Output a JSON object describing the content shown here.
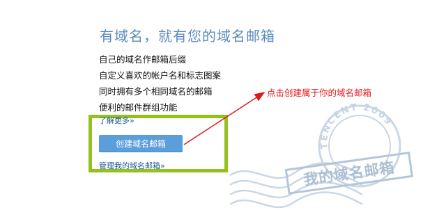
{
  "headline": "有域名，就有您的域名邮箱",
  "features": [
    "自己的域名作邮箱后缀",
    "自定义喜欢的帐户名和标志图案",
    "同时拥有多个相同域名的邮箱",
    "便利的邮件群组功能"
  ],
  "links": {
    "learn_more": "了解更多»",
    "manage": "管理我的域名邮箱»"
  },
  "buttons": {
    "create": "创建域名邮箱"
  },
  "annotation": {
    "text": "点击创建属于你的域名邮箱",
    "color": "#e0191f"
  },
  "stamp": {
    "ring_text": "TENCENT 2009",
    "label": "我的域名邮箱"
  },
  "colors": {
    "highlight_border": "#95c11f",
    "button_bg": "#5b9edc",
    "link": "#1b5a96",
    "headline": "#5a8bbd",
    "stamp": "#b8c8da"
  }
}
